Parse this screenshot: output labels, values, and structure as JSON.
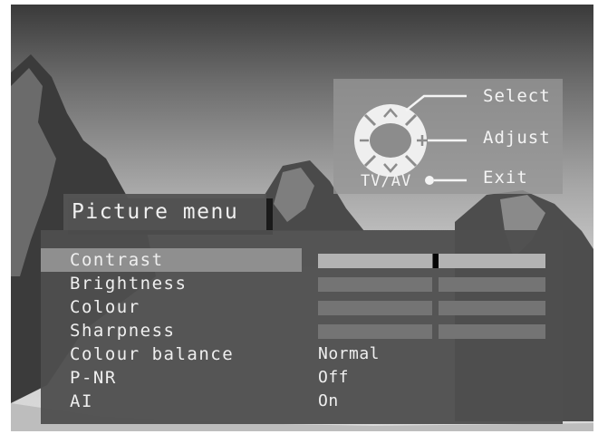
{
  "colors": {
    "panel_bg": "#4e4e4e",
    "selected_row_bg": "#8f8f8f",
    "slider_active": "#b3b3b3",
    "slider_inactive": "#747474",
    "text": "#efefef"
  },
  "help": {
    "select_label": "Select",
    "adjust_label": "Adjust",
    "exit_label": "Exit",
    "tvav_label": "TV/AV",
    "icons": [
      "dpad-icon",
      "up-arrow-icon",
      "down-arrow-icon",
      "minus-icon",
      "plus-icon",
      "tvav-button-icon"
    ]
  },
  "menu": {
    "title": "Picture menu",
    "selected_index": 0,
    "items": [
      {
        "label": "Contrast",
        "type": "slider",
        "level": 0.5
      },
      {
        "label": "Brightness",
        "type": "slider",
        "level": 0.5
      },
      {
        "label": "Colour",
        "type": "slider",
        "level": 0.5
      },
      {
        "label": "Sharpness",
        "type": "slider",
        "level": 0.5
      },
      {
        "label": "Colour balance",
        "type": "value",
        "value": "Normal"
      },
      {
        "label": "P-NR",
        "type": "value",
        "value": "Off"
      },
      {
        "label": "AI",
        "type": "value",
        "value": "On"
      }
    ]
  }
}
